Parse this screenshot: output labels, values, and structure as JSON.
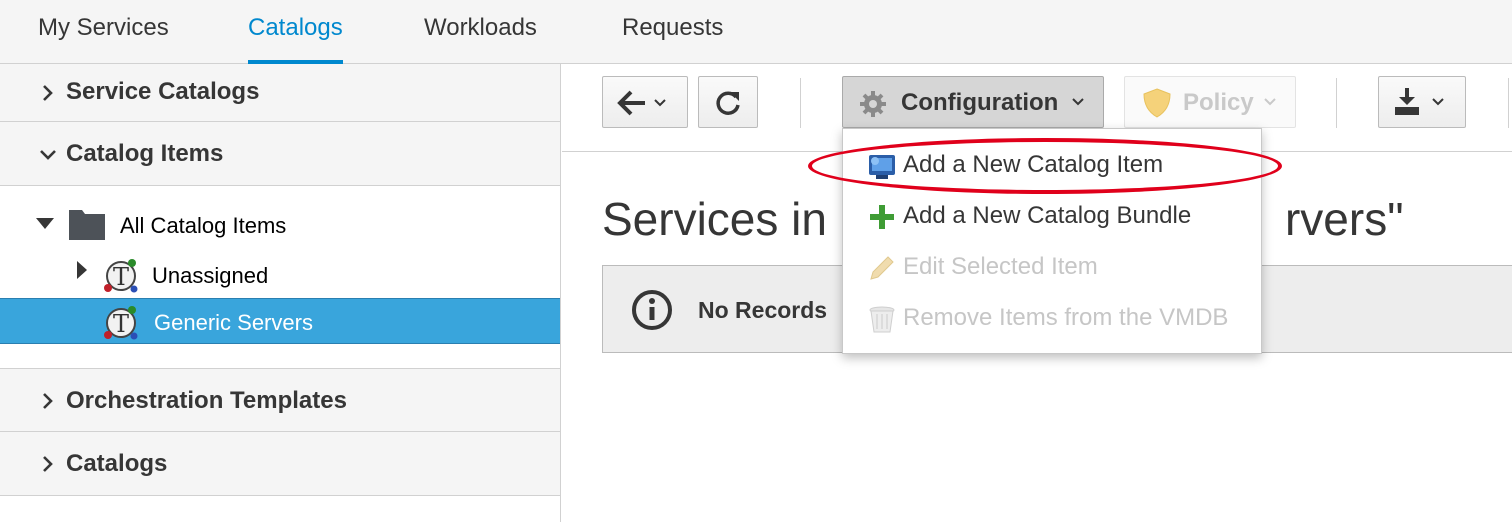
{
  "topnav": {
    "tabs": [
      {
        "label": "My Services"
      },
      {
        "label": "Catalogs"
      },
      {
        "label": "Workloads"
      },
      {
        "label": "Requests"
      }
    ]
  },
  "sidebar": {
    "accordions": [
      {
        "label": "Service Catalogs",
        "expanded": false
      },
      {
        "label": "Catalog Items",
        "expanded": true
      },
      {
        "label": "Orchestration Templates",
        "expanded": false
      },
      {
        "label": "Catalogs",
        "expanded": false
      }
    ],
    "tree": {
      "root": {
        "label": "All Catalog Items",
        "icon": "folder-icon"
      },
      "children": [
        {
          "label": "Unassigned",
          "icon": "template-icon",
          "selected": false
        },
        {
          "label": "Generic Servers",
          "icon": "template-icon",
          "selected": true
        }
      ]
    }
  },
  "toolbar": {
    "back": {
      "icon": "arrow-left-icon"
    },
    "reload": {
      "icon": "reload-icon"
    },
    "configuration": {
      "label": "Configuration",
      "icon": "gear-icon"
    },
    "policy": {
      "label": "Policy",
      "icon": "shield-icon",
      "disabled": true
    },
    "download": {
      "icon": "download-icon"
    }
  },
  "main": {
    "title_left": "Services in",
    "title_right": "rvers\"",
    "alert": {
      "text": "No Records",
      "icon": "info-icon"
    }
  },
  "config_menu": {
    "items": [
      {
        "label": "Add a New Catalog Item",
        "icon": "catalog-item-icon",
        "disabled": false
      },
      {
        "label": "Add a New Catalog Bundle",
        "icon": "plus-icon",
        "disabled": false
      },
      {
        "label": "Edit Selected Item",
        "icon": "pencil-icon",
        "disabled": true
      },
      {
        "label": "Remove Items from the VMDB",
        "icon": "trash-icon",
        "disabled": true
      }
    ]
  },
  "colors": {
    "accent": "#0088ce",
    "selected_row": "#39a5dc",
    "highlight_ring": "#e0001b"
  }
}
